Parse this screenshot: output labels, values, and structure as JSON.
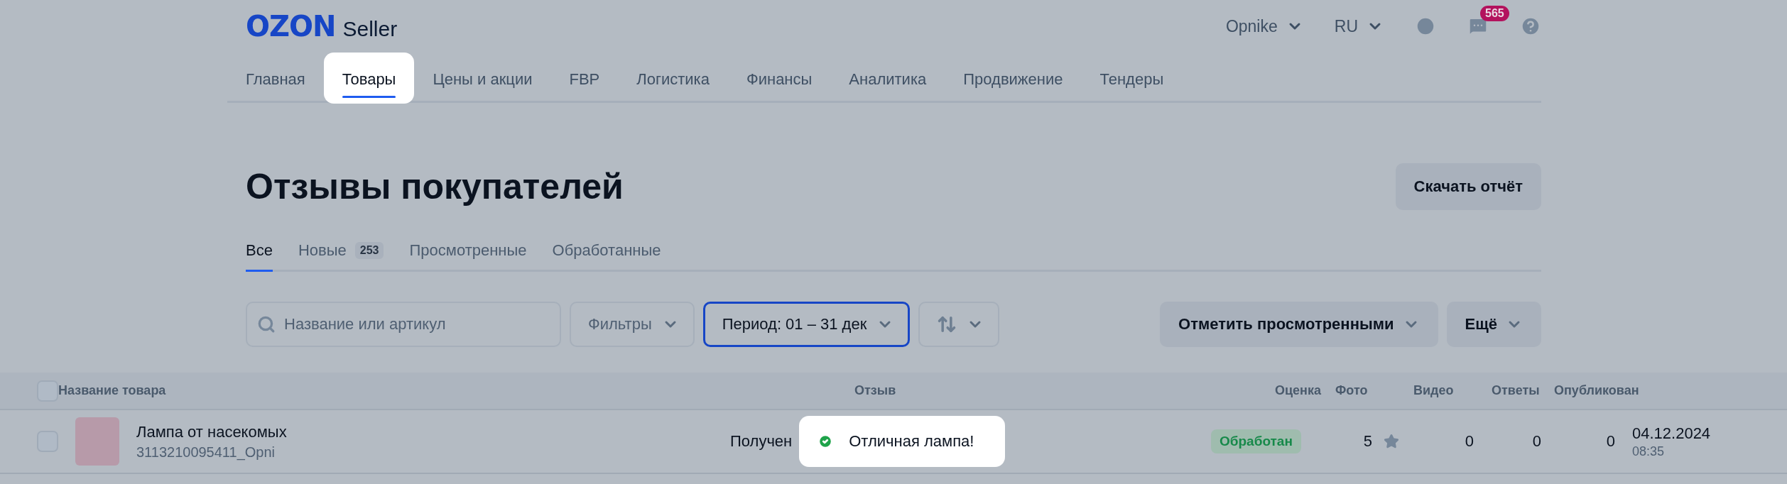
{
  "header": {
    "logo": "OZON",
    "logo_suffix": "Seller",
    "account": "Opnike",
    "language": "RU",
    "messages_badge": "565"
  },
  "nav": [
    {
      "label": "Главная",
      "selected": false
    },
    {
      "label": "Товары",
      "selected": true
    },
    {
      "label": "Цены и акции",
      "selected": false
    },
    {
      "label": "FBP",
      "selected": false
    },
    {
      "label": "Логистика",
      "selected": false
    },
    {
      "label": "Финансы",
      "selected": false
    },
    {
      "label": "Аналитика",
      "selected": false
    },
    {
      "label": "Продвижение",
      "selected": false
    },
    {
      "label": "Тендеры",
      "selected": false
    }
  ],
  "page": {
    "title": "Отзывы покупателей",
    "download_button": "Скачать отчёт"
  },
  "tabs": [
    {
      "label": "Все",
      "selected": true
    },
    {
      "label": "Новые",
      "count": "253",
      "selected": false
    },
    {
      "label": "Просмотренные",
      "selected": false
    },
    {
      "label": "Обработанные",
      "selected": false
    }
  ],
  "filters": {
    "search_placeholder": "Название или артикул",
    "filters_button": "Фильтры",
    "period_button": {
      "label": "Период: 01 – 31 дек",
      "active": true
    },
    "mark_viewed_button": "Отметить просмотренными",
    "more_button": "Ещё"
  },
  "table": {
    "header_checked": false,
    "columns": [
      "Название товара",
      "Отзыв",
      "Оценка",
      "Фото",
      "Видео",
      "Ответы",
      "Опубликован"
    ],
    "rows": [
      {
        "checked": false,
        "product": "Лампа от насекомых",
        "sku": "3113210095411_Opni",
        "review_status": "Получен",
        "review_text": "Отличная лампа!",
        "status": "Обработан",
        "rating": "5",
        "photos": "0",
        "videos": "0",
        "answers": "0",
        "date": "04.12.2024",
        "time": "08:35"
      }
    ]
  }
}
